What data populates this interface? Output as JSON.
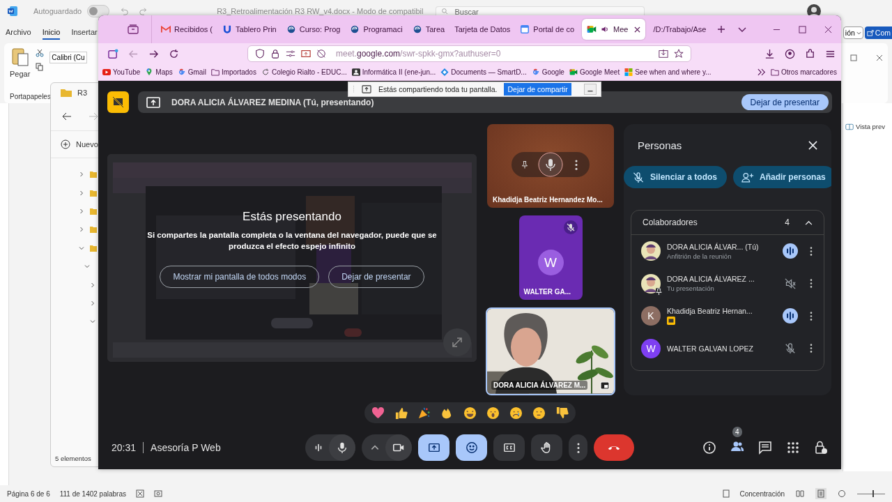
{
  "word": {
    "autosave_label": "Autoguardado",
    "autosave_on": false,
    "title": "R3_Retroalimentación R3 RW_v4.docx - Modo de compatibil",
    "search_placeholder": "Buscar",
    "menu": [
      {
        "label": "Archivo",
        "selected": false
      },
      {
        "label": "Inicio",
        "selected": true
      },
      {
        "label": "Insertar",
        "selected": false
      }
    ],
    "paste_label": "Pegar",
    "clipboard_group": "Portapapeles",
    "font_name": "Calibri (Cu",
    "share_dropdown": "ión",
    "comments_button": "Com",
    "preview_label": "Vista prev",
    "status": {
      "page": "Página 6 de 6",
      "words": "111 de 1402 palabras",
      "focus": "Concentración",
      "zoom": {
        "level": 0.55
      }
    }
  },
  "explorer": {
    "title": "R3",
    "new_label": "Nuevo",
    "item_count": "5 elementos",
    "tree": [
      {
        "expanded": false
      },
      {
        "expanded": false
      },
      {
        "expanded": false
      },
      {
        "expanded": false
      },
      {
        "expanded": true,
        "children": [
          {
            "expanded": true,
            "children": [
              {
                "expanded": false
              },
              {
                "expanded": false
              },
              {
                "expanded": true
              }
            ]
          }
        ]
      }
    ]
  },
  "browser": {
    "tabs": [
      {
        "label": "Recibidos (",
        "kind": "mail",
        "selected": false,
        "audio": false
      },
      {
        "label": "Tablero Prin",
        "kind": "board",
        "selected": false,
        "audio": false
      },
      {
        "label": "Curso: Prog",
        "kind": "course",
        "selected": false,
        "audio": false
      },
      {
        "label": "Programaci",
        "kind": "course",
        "selected": false,
        "audio": false
      },
      {
        "label": "Tarea",
        "kind": "course",
        "selected": false,
        "audio": false
      },
      {
        "label": "Tarjeta de Datos",
        "kind": "text",
        "selected": false,
        "audio": false
      },
      {
        "label": "Portal de co",
        "kind": "calendar",
        "selected": false,
        "audio": false
      },
      {
        "label": "Mee",
        "kind": "meet",
        "selected": true,
        "audio": true
      },
      {
        "label": "/D:/Trabajo/Ase",
        "kind": "text",
        "selected": false,
        "audio": false
      }
    ],
    "address": {
      "subdomain": "meet.",
      "domain": "google.com",
      "path": "/swr-spkk-gmx?authuser=0"
    },
    "bookmarks": [
      {
        "label": "YouTube",
        "kind": "video"
      },
      {
        "label": "Maps",
        "kind": "pin"
      },
      {
        "label": "Gmail",
        "kind": "g"
      },
      {
        "label": "Importados",
        "kind": "folder"
      },
      {
        "label": "Colegio Rialto - EDUC...",
        "kind": "refresh"
      },
      {
        "label": "Informática II (ene-jun...",
        "kind": "contact"
      },
      {
        "label": "Documents — SmartD...",
        "kind": "diamond"
      },
      {
        "label": "Google",
        "kind": "g"
      },
      {
        "label": "Google Meet",
        "kind": "meet"
      },
      {
        "label": "See when and where y...",
        "kind": "windows"
      }
    ],
    "other_bookmarks": "Otros marcadores"
  },
  "share_bar": {
    "message": "Estás compartiendo toda tu pantalla.",
    "stop_button": "Dejar de compartir"
  },
  "meet": {
    "presenter_banner": "DORA ALICIA ÁLVAREZ MEDINA (Tú, presentando)",
    "stop_presenting": "Dejar de presentar",
    "preview": {
      "title": "Estás presentando",
      "message": "Si compartes la pantalla completa o la ventana del navegador, puede que se produzca el efecto espejo infinito",
      "show_anyway": "Mostrar mi pantalla de todos modos",
      "stop": "Dejar de presentar"
    },
    "tiles": [
      {
        "kind": "hover",
        "name": "Khadidja Beatriz Hernandez Mo..."
      },
      {
        "kind": "avatar",
        "name": "WALTER GA...",
        "letter": "W",
        "muted": true
      },
      {
        "kind": "camera",
        "name": "DORA ALICIA ÁLVAREZ M..."
      }
    ],
    "people": {
      "title": "Personas",
      "mute_all": "Silenciar a todos",
      "add_people": "Añadir personas",
      "section": "Colaboradores",
      "count": "4",
      "expanded": true,
      "participants": [
        {
          "name": "DORA ALICIA ÁLVAR... (Tú)",
          "subtitle": "Anfitrión de la reunión",
          "kind": "host",
          "presenting": false,
          "speaking": true
        },
        {
          "name": "DORA ALICIA ÁLVAREZ ...",
          "subtitle": "Tu presentación",
          "kind": "presentation",
          "presenting": false,
          "speaking": false
        },
        {
          "name": "Khadidja Beatriz Hernan...",
          "kind": "guest",
          "letter": "K",
          "color": "#8d6e63",
          "presenting": true,
          "speaking": true
        },
        {
          "name": "WALTER GALVAN LOPEZ",
          "kind": "guest",
          "letter": "W",
          "color": "#7e3ff2",
          "presenting": false,
          "speaking": false
        }
      ]
    },
    "reactions": [
      {
        "kind": "heart"
      },
      {
        "kind": "thumbs-up"
      },
      {
        "kind": "party"
      },
      {
        "kind": "clap"
      },
      {
        "kind": "laugh"
      },
      {
        "kind": "surprised"
      },
      {
        "kind": "sad"
      },
      {
        "kind": "thinking"
      },
      {
        "kind": "thumbs-down"
      }
    ],
    "meeting_time": "20:31",
    "meeting_name": "Asesoría P Web",
    "controls": [
      {
        "kind": "mic",
        "selected": false
      },
      {
        "kind": "camera",
        "selected": false
      },
      {
        "kind": "present",
        "selected": true
      },
      {
        "kind": "reactions",
        "selected": true
      },
      {
        "kind": "captions",
        "selected": false
      },
      {
        "kind": "hand",
        "selected": false
      },
      {
        "kind": "more",
        "selected": false
      },
      {
        "kind": "leave",
        "selected": false
      }
    ],
    "people_badge": "4"
  }
}
